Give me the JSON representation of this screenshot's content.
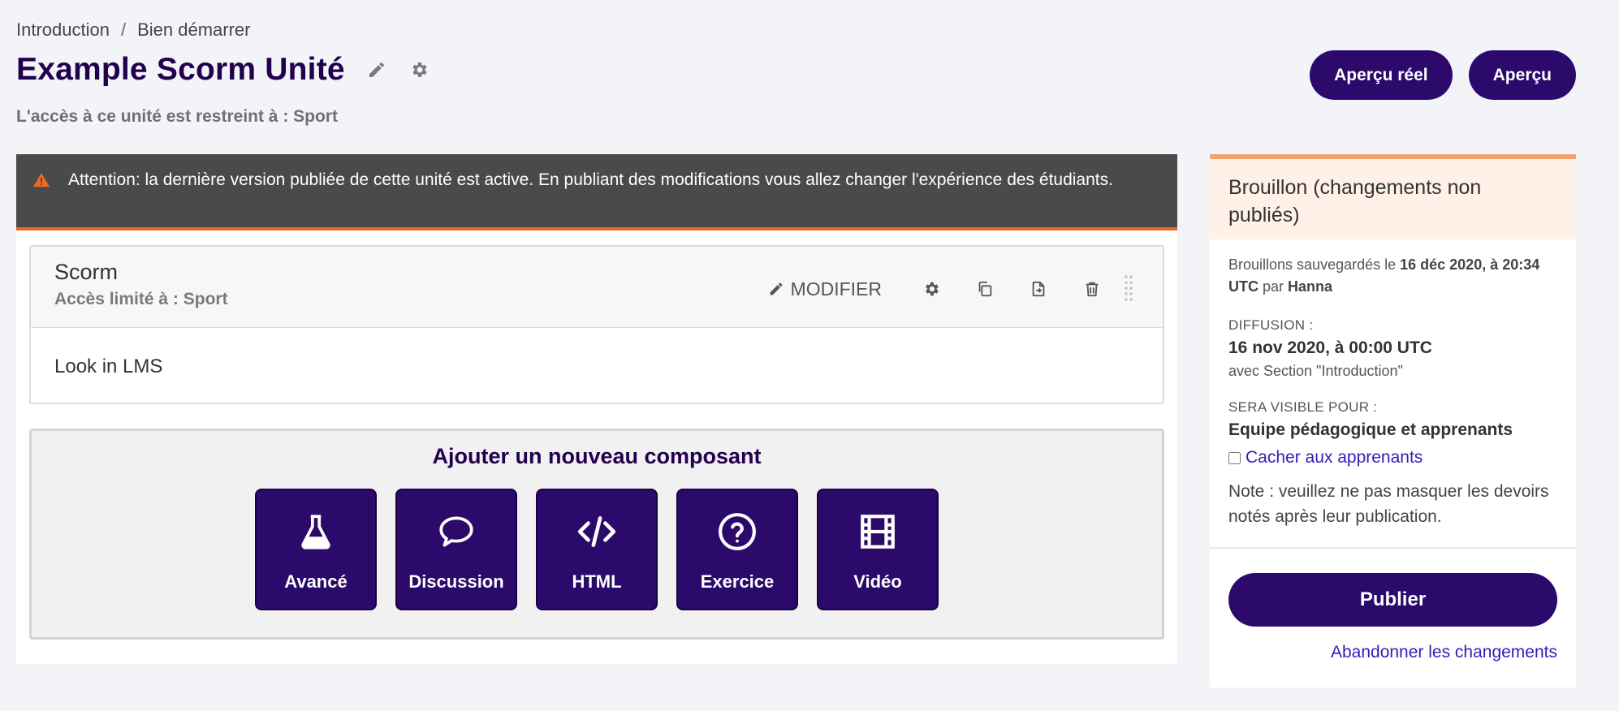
{
  "breadcrumb": {
    "items": [
      "Introduction",
      "Bien démarrer"
    ],
    "separator": "/"
  },
  "header": {
    "title": "Example Scorm Unité",
    "restriction": "L'accès à ce unité est restreint à : Sport",
    "buttons": {
      "preview_real": "Aperçu réel",
      "preview": "Aperçu"
    }
  },
  "warning": {
    "text": "Attention: la dernière version publiée de cette unité est active. En publiant des modifications vous allez changer l'expérience des étudiants."
  },
  "component": {
    "title": "Scorm",
    "subtitle": "Accès limité à : Sport",
    "edit_label": "MODIFIER",
    "body": "Look in LMS"
  },
  "add_panel": {
    "title": "Ajouter un nouveau composant",
    "buttons": [
      {
        "label": "Avancé",
        "icon": "flask-icon"
      },
      {
        "label": "Discussion",
        "icon": "speech-bubble-icon"
      },
      {
        "label": "HTML",
        "icon": "code-icon"
      },
      {
        "label": "Exercice",
        "icon": "question-circle-icon"
      },
      {
        "label": "Vidéo",
        "icon": "film-icon"
      }
    ]
  },
  "sidebar": {
    "status": "Brouillon (changements non publiés)",
    "saved_prefix": "Brouillons sauvegardés le ",
    "saved_date": "16 déc 2020, à 20:34 UTC",
    "saved_by_prefix": " par ",
    "saved_by": "Hanna",
    "release_label": "DIFFUSION :",
    "release_date": "16 nov 2020, à 00:00 UTC",
    "release_with": "avec Section \"Introduction\"",
    "visible_label": "SERA VISIBLE POUR :",
    "visible_to": "Equipe pédagogique et apprenants",
    "hide_label": "Cacher aux apprenants",
    "note": "Note : veuillez ne pas masquer les devoirs notés après leur publication.",
    "publish": "Publier",
    "discard": "Abandonner les changements"
  },
  "colors": {
    "brand": "#2c0a6b",
    "title": "#23004d",
    "warning_bg": "#4a4a4a",
    "warning_accent": "#e86b1f",
    "draft_bg": "#fff1e8",
    "draft_accent": "#f2a36a",
    "link": "#3a1ab8"
  }
}
